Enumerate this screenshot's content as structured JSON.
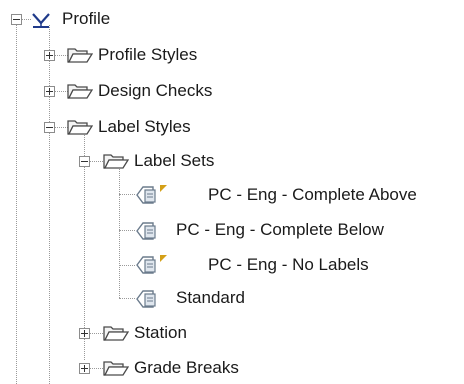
{
  "tree": {
    "root": {
      "label": "Profile",
      "icon": "profile-icon"
    },
    "items": [
      {
        "label": "Profile Styles",
        "icon": "folder-icon",
        "expanded": false
      },
      {
        "label": "Design Checks",
        "icon": "folder-icon",
        "expanded": false
      },
      {
        "label": "Label Styles",
        "icon": "folder-icon",
        "expanded": true
      },
      {
        "label": "Station",
        "icon": "folder-icon",
        "expanded": false
      },
      {
        "label": "Grade Breaks",
        "icon": "folder-icon",
        "expanded": false
      }
    ],
    "label_sets": {
      "label": "Label Sets",
      "icon": "folder-icon",
      "children": [
        {
          "label": "PC - Eng - Complete Above",
          "icon": "label-set-icon",
          "flagged": true
        },
        {
          "label": "PC - Eng - Complete Below",
          "icon": "label-set-icon",
          "flagged": false
        },
        {
          "label": "PC - Eng - No Labels",
          "icon": "label-set-icon",
          "flagged": true
        },
        {
          "label": "Standard",
          "icon": "label-set-icon",
          "flagged": false
        }
      ]
    }
  },
  "colors": {
    "profile_icon": "#1f3a8a",
    "folder_outline": "#4a4a4a",
    "flag": "#d4a017",
    "label_icon": "#6b7b8c"
  }
}
